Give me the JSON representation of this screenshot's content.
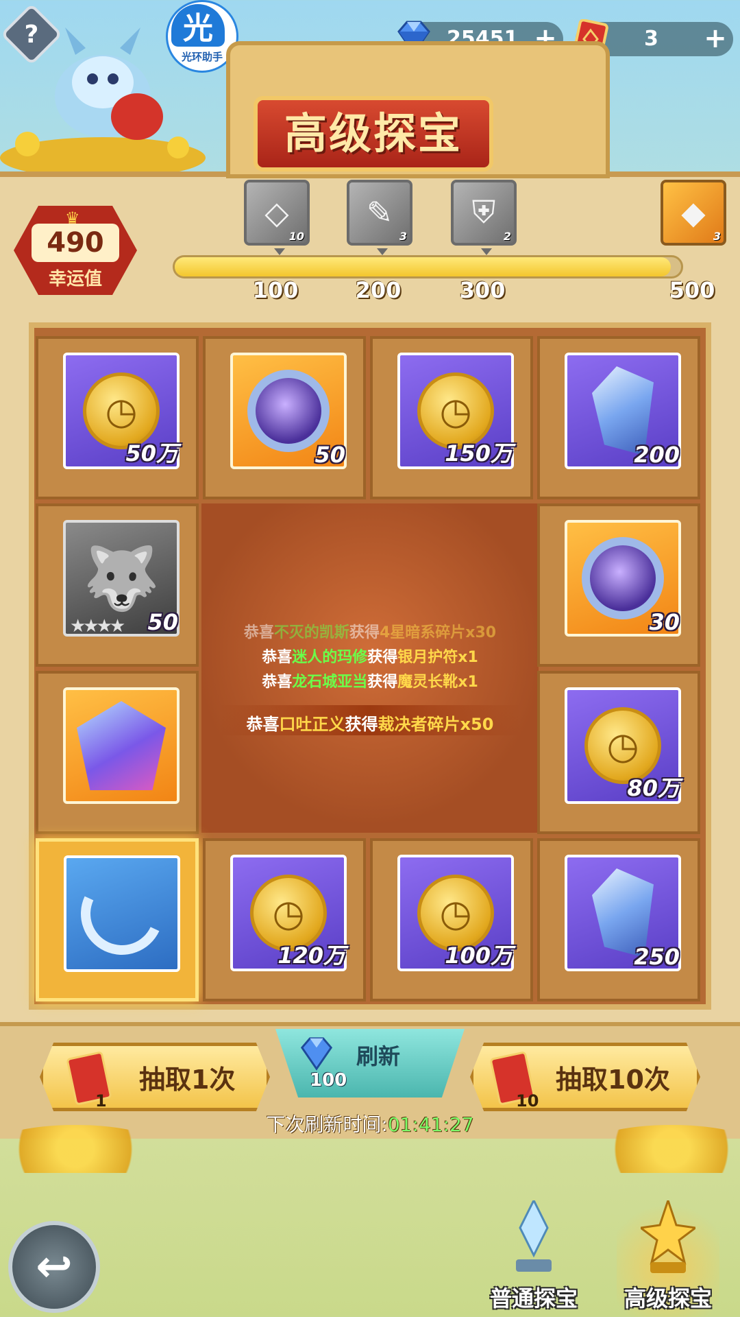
{
  "header": {
    "help_label": "?",
    "logo_glyph": "光",
    "logo_text": "光环助手",
    "title": "高级探宝"
  },
  "resources": {
    "gems": "25451",
    "cards": "3",
    "plus": "+"
  },
  "luck": {
    "value": "490",
    "label": "幸运值"
  },
  "progress": {
    "current": 490,
    "max": 500,
    "milestones": [
      {
        "value": "100",
        "count": "10",
        "icon": "card-icon"
      },
      {
        "value": "200",
        "count": "3",
        "icon": "scroll-icon"
      },
      {
        "value": "300",
        "count": "2",
        "icon": "armor-icon"
      },
      {
        "value": "500",
        "count": "3",
        "icon": "gem-chest-icon"
      }
    ]
  },
  "grid": {
    "items": [
      {
        "qty": "50万",
        "kind": "gold-coin-icon"
      },
      {
        "qty": "50",
        "kind": "magic-orb-icon"
      },
      {
        "qty": "150万",
        "kind": "gold-coin-icon"
      },
      {
        "qty": "200",
        "kind": "crystal-icon"
      },
      {
        "qty": "50",
        "kind": "dark-hero-shard-icon"
      },
      {
        "qty": "30",
        "kind": "magic-orb-icon"
      },
      {
        "qty": "",
        "kind": "rainbow-gem-icon"
      },
      {
        "qty": "80万",
        "kind": "gold-coin-icon"
      },
      {
        "qty": "",
        "kind": "hook-amulet-icon"
      },
      {
        "qty": "120万",
        "kind": "gold-coin-icon"
      },
      {
        "qty": "100万",
        "kind": "gold-coin-icon"
      },
      {
        "qty": "250",
        "kind": "crystal-icon"
      }
    ],
    "coin_glyph": "◷"
  },
  "log": [
    {
      "pre": "恭喜",
      "name": "不灭的凯斯",
      "mid": "获得",
      "item": "4星暗系碎片x30"
    },
    {
      "pre": "恭喜",
      "name": "迷人的玛修",
      "mid": "获得",
      "item": "银月护符x1"
    },
    {
      "pre": "恭喜",
      "name": "龙石城亚当",
      "mid": "获得",
      "item": "魔灵长靴x1"
    },
    {
      "pre": "恭喜",
      "name": "口吐正义",
      "mid": "获得",
      "item": "裁决者碎片x50"
    }
  ],
  "controls": {
    "draw_one_label": "抽取1次",
    "draw_one_cost": "1",
    "draw_ten_label": "抽取10次",
    "draw_ten_cost": "10",
    "refresh_label": "刷新",
    "refresh_cost": "100",
    "next_refresh_label": "下次刷新时间:",
    "next_refresh_time": "01:41:27"
  },
  "nav": {
    "back_glyph": "↩",
    "normal_label": "普通探宝",
    "advanced_label": "高级探宝"
  },
  "colors": {
    "accent_red": "#b42a1c",
    "gold": "#f3c62d",
    "name_green": "#6bff4a",
    "item_yellow": "#ffd84a",
    "timer_green": "#7dff6a"
  }
}
